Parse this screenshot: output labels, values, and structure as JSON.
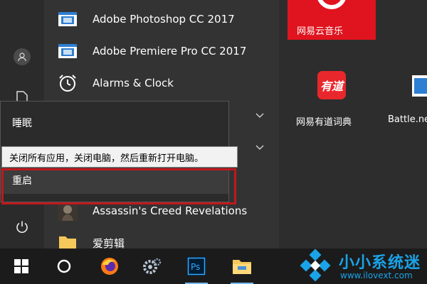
{
  "apps": [
    {
      "label": "Adobe Photoshop CC 2017",
      "icon": "app-window-icon"
    },
    {
      "label": "Adobe Premiere Pro CC 2017",
      "icon": "app-window-icon"
    },
    {
      "label": "Alarms & Clock",
      "icon": "alarm-clock-icon"
    },
    {
      "label": "Assassin's Creed Revelations",
      "icon": "game-icon"
    },
    {
      "label": "爱剪辑",
      "icon": "folder-icon"
    }
  ],
  "tiles": {
    "music_label": "网易云音乐",
    "youdao_label": "网易有道词典",
    "youdao_logo_text": "有道",
    "battle_label": "Battle.ne"
  },
  "power_menu": {
    "sleep_label": "睡眠",
    "restart_label": "重启",
    "tooltip": "关闭所有应用，关闭电脑，然后重新打开电脑。"
  },
  "watermark": {
    "title": "小小系统迷",
    "url": "www.ilovext.com"
  },
  "colors": {
    "music_tile": "#e0141e",
    "youdao_red": "#e8272c",
    "highlight_frame": "#c0181d",
    "accent": "#1aa3e8"
  }
}
